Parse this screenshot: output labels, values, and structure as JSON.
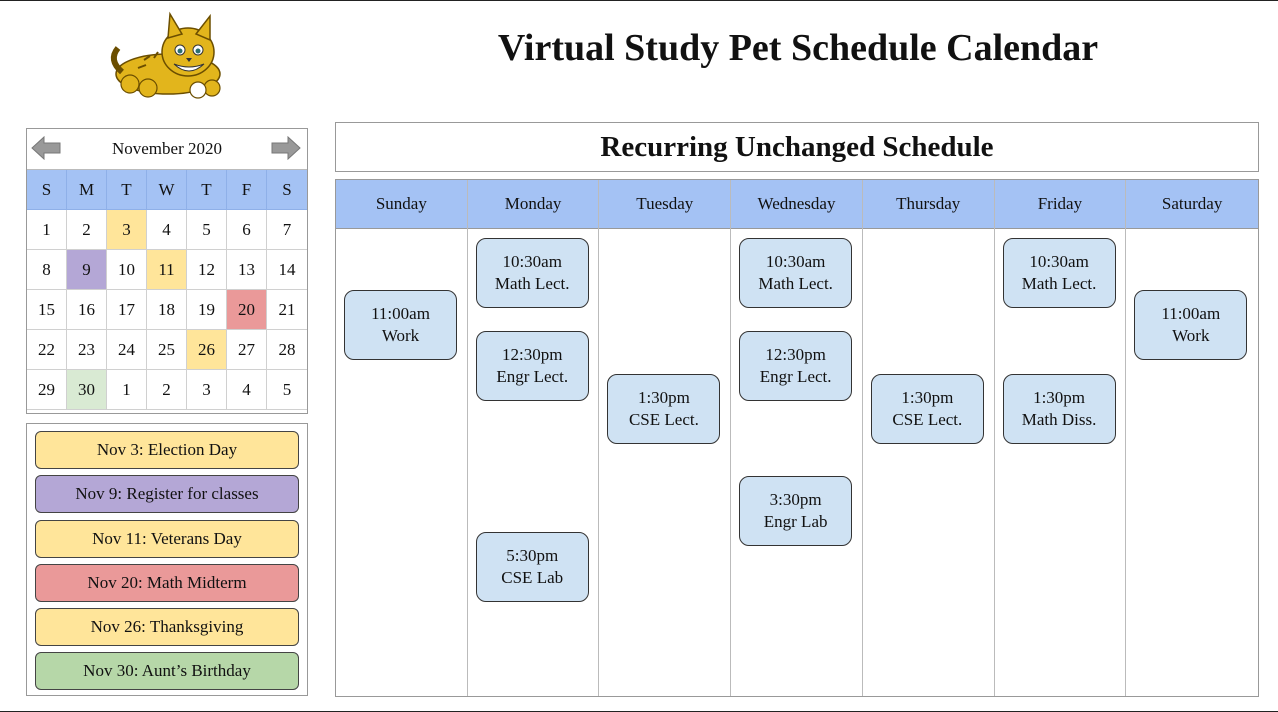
{
  "page": {
    "title": "Virtual Study Pet Schedule Calendar",
    "logo_icon": "bobcat-mascot-icon"
  },
  "mini_calendar": {
    "month_label": "November 2020",
    "prev_icon": "arrow-left-icon",
    "next_icon": "arrow-right-icon",
    "weekday_labels": [
      "S",
      "M",
      "T",
      "W",
      "T",
      "F",
      "S"
    ],
    "weeks": [
      [
        "1",
        "2",
        "3",
        "4",
        "5",
        "6",
        "7"
      ],
      [
        "8",
        "9",
        "10",
        "11",
        "12",
        "13",
        "14"
      ],
      [
        "15",
        "16",
        "17",
        "18",
        "19",
        "20",
        "21"
      ],
      [
        "22",
        "23",
        "24",
        "25",
        "26",
        "27",
        "28"
      ],
      [
        "29",
        "30",
        "1",
        "2",
        "3",
        "4",
        "5"
      ]
    ],
    "highlights": {
      "3": "yellow",
      "9": "purple",
      "11": "yellow",
      "20": "red",
      "26": "yellow",
      "30": "green"
    }
  },
  "events": [
    {
      "label": "Nov 3: Election Day",
      "color": "#ffe59a"
    },
    {
      "label": "Nov 9: Register for classes",
      "color": "#b4a7d6"
    },
    {
      "label": "Nov 11: Veterans Day",
      "color": "#ffe59a"
    },
    {
      "label": "Nov 20: Math Midterm",
      "color": "#ea9999"
    },
    {
      "label": "Nov 26: Thanksgiving",
      "color": "#ffe59a"
    },
    {
      "label": "Nov 30: Aunt’s Birthday",
      "color": "#b6d7a8"
    }
  ],
  "schedule": {
    "title": "Recurring Unchanged Schedule",
    "days": [
      {
        "name": "Sunday",
        "slots": [
          {
            "time": "11:00am",
            "label": "Work"
          }
        ]
      },
      {
        "name": "Monday",
        "slots": [
          {
            "time": "10:30am",
            "label": "Math Lect."
          },
          {
            "time": "12:30pm",
            "label": "Engr Lect."
          },
          {
            "time": "5:30pm",
            "label": "CSE Lab"
          }
        ]
      },
      {
        "name": "Tuesday",
        "slots": [
          {
            "time": "1:30pm",
            "label": "CSE Lect."
          }
        ]
      },
      {
        "name": "Wednesday",
        "slots": [
          {
            "time": "10:30am",
            "label": "Math Lect."
          },
          {
            "time": "12:30pm",
            "label": "Engr Lect."
          },
          {
            "time": "3:30pm",
            "label": "Engr Lab"
          }
        ]
      },
      {
        "name": "Thursday",
        "slots": [
          {
            "time": "1:30pm",
            "label": "CSE Lect."
          }
        ]
      },
      {
        "name": "Friday",
        "slots": [
          {
            "time": "10:30am",
            "label": "Math Lect."
          },
          {
            "time": "1:30pm",
            "label": "Math Diss."
          }
        ]
      },
      {
        "name": "Saturday",
        "slots": [
          {
            "time": "11:00am",
            "label": "Work"
          }
        ]
      }
    ]
  }
}
